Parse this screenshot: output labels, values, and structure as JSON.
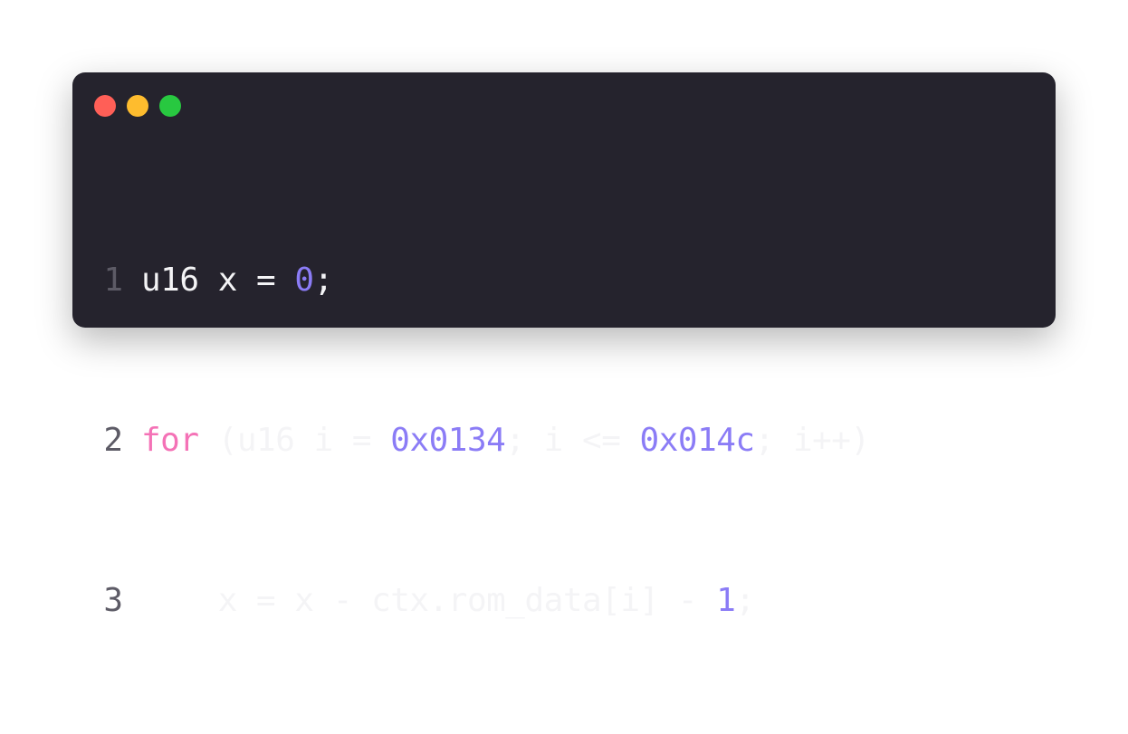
{
  "colors": {
    "window_bg": "#25232d",
    "close": "#ff5f57",
    "minimize": "#febc2e",
    "maximize": "#28c840",
    "keyword": "#f472b6",
    "number": "#8b7cf6",
    "text": "#f4f4f6",
    "line_number": "#5d5b66"
  },
  "window_controls": [
    {
      "name": "close-button",
      "icon": "red-dot-icon"
    },
    {
      "name": "minimize-button",
      "icon": "yellow-dot-icon"
    },
    {
      "name": "maximize-button",
      "icon": "green-dot-icon"
    }
  ],
  "code": {
    "lines": [
      {
        "number": "1",
        "tokens": [
          {
            "text": "u16 x = ",
            "type": "plain"
          },
          {
            "text": "0",
            "type": "num"
          },
          {
            "text": ";",
            "type": "plain"
          }
        ]
      },
      {
        "number": "2",
        "tokens": [
          {
            "text": "for",
            "type": "kw"
          },
          {
            "text": " (u16 i = ",
            "type": "plain"
          },
          {
            "text": "0x0134",
            "type": "num"
          },
          {
            "text": "; i <= ",
            "type": "plain"
          },
          {
            "text": "0x014c",
            "type": "num"
          },
          {
            "text": "; i++)",
            "type": "plain"
          }
        ]
      },
      {
        "number": "3",
        "tokens": [
          {
            "text": "    x = x - ctx.rom_data[i] - ",
            "type": "plain"
          },
          {
            "text": "1",
            "type": "num"
          },
          {
            "text": ";",
            "type": "plain"
          }
        ]
      }
    ]
  }
}
